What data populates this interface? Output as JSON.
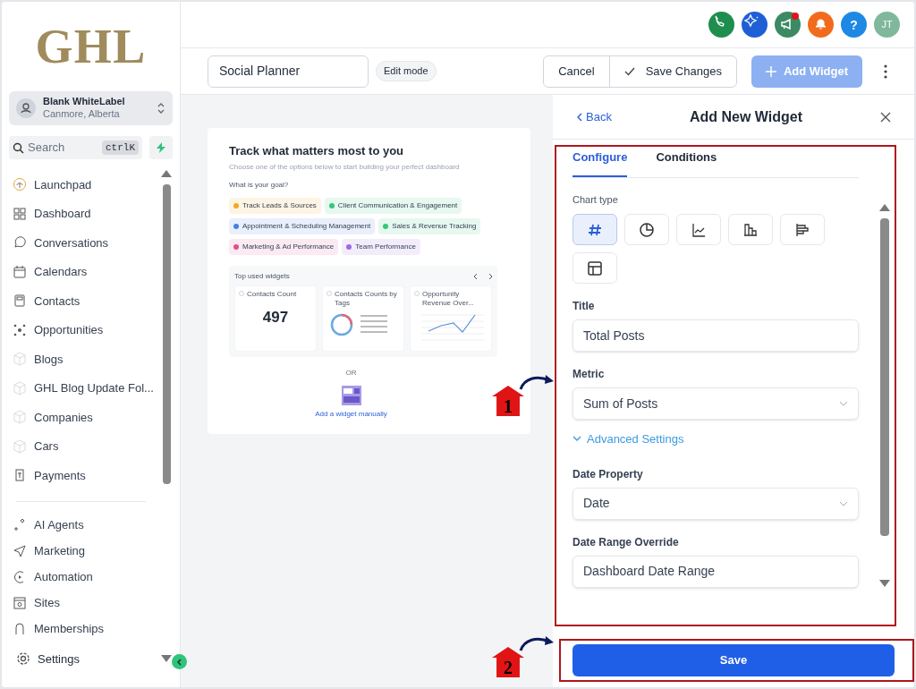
{
  "sidebar": {
    "logo": "GHL",
    "account": {
      "name": "Blank WhiteLabel",
      "location": "Canmore, Alberta"
    },
    "search": {
      "placeholder": "Search",
      "shortcut": "ctrlK"
    },
    "items": [
      {
        "label": "Launchpad",
        "selected": false
      },
      {
        "label": "Dashboard",
        "selected": false
      },
      {
        "label": "Conversations",
        "selected": false
      },
      {
        "label": "Calendars",
        "selected": false
      },
      {
        "label": "Contacts",
        "selected": false
      },
      {
        "label": "Opportunities",
        "selected": false
      },
      {
        "label": "Blogs",
        "selected": false
      },
      {
        "label": "GHL Blog Update Fol...",
        "selected": false
      },
      {
        "label": "Companies",
        "selected": false
      },
      {
        "label": "Cars",
        "selected": false
      },
      {
        "label": "Payments",
        "selected": false
      }
    ],
    "items_2": [
      {
        "label": "AI Agents"
      },
      {
        "label": "Marketing"
      },
      {
        "label": "Automation"
      },
      {
        "label": "Sites"
      },
      {
        "label": "Memberships"
      }
    ],
    "settings": "Settings"
  },
  "header": {
    "avatar": "JT",
    "icons": [
      {
        "kind": "phone",
        "color": "#1e8e4e",
        "badge": false
      },
      {
        "kind": "sparkle",
        "color": "#1f5fd6",
        "badge": false
      },
      {
        "kind": "megaphone",
        "color": "#3b8a63",
        "badge": true
      },
      {
        "kind": "bell",
        "color": "#f26b1d",
        "badge": false
      },
      {
        "kind": "help",
        "color": "#1e88e5",
        "badge": false,
        "label": "?"
      }
    ]
  },
  "toolbar": {
    "dashboard_name": "Social Planner",
    "mode": "Edit mode",
    "cancel": "Cancel",
    "save_changes": "Save Changes",
    "add_widget": {
      "label": "Add Widget",
      "disabled": true
    }
  },
  "preview": {
    "title": "Track what matters most to you",
    "subtitle": "Choose one of the options below to start building your perfect dashboard",
    "question": "What is your goal?",
    "goals": [
      {
        "label": "Track Leads & Sources",
        "color": "#f5a623"
      },
      {
        "label": "Client Communication & Engagement",
        "color": "#34c77b"
      },
      {
        "label": "Appointment & Scheduling Management",
        "color": "#4a7fe0"
      },
      {
        "label": "Sales & Revenue Tracking",
        "color": "#34c77b"
      },
      {
        "label": "Marketing & Ad Performance",
        "color": "#e0508a"
      },
      {
        "label": "Team Performance",
        "color": "#9b6be0"
      }
    ],
    "top_used": {
      "title": "Top used widgets",
      "widgets": [
        {
          "kind": "number",
          "title": "Contacts Count",
          "value": "497"
        },
        {
          "kind": "donut",
          "title": "Contacts Counts by Tags"
        },
        {
          "kind": "line",
          "title": "Opportunity Revenue Over..."
        }
      ]
    },
    "separator": "OR",
    "add_manually": "Add a widget manually"
  },
  "panel": {
    "back": "Back",
    "title": "Add New Widget",
    "tabs": [
      {
        "label": "Configure",
        "selected": true
      },
      {
        "label": "Conditions",
        "selected": false
      }
    ],
    "chart_type_label": "Chart type",
    "chart_types": [
      {
        "kind": "number",
        "selected": true
      },
      {
        "kind": "pie",
        "selected": false
      },
      {
        "kind": "line",
        "selected": false
      },
      {
        "kind": "bar",
        "selected": false
      },
      {
        "kind": "hbar",
        "selected": false
      },
      {
        "kind": "table",
        "selected": false
      }
    ],
    "fields": [
      {
        "kind": "text",
        "label": "Title",
        "value": "Total Posts"
      },
      {
        "kind": "select",
        "label": "Metric",
        "value": "Sum of Posts"
      },
      {
        "kind": "toggle",
        "label": "Advanced Settings",
        "expanded": true
      },
      {
        "kind": "select",
        "label": "Date Property",
        "value": "Date"
      },
      {
        "kind": "text",
        "label": "Date Range Override",
        "value": "Dashboard Date Range"
      }
    ],
    "save": "Save"
  },
  "annotations": [
    {
      "label": "1"
    },
    {
      "label": "2"
    }
  ]
}
